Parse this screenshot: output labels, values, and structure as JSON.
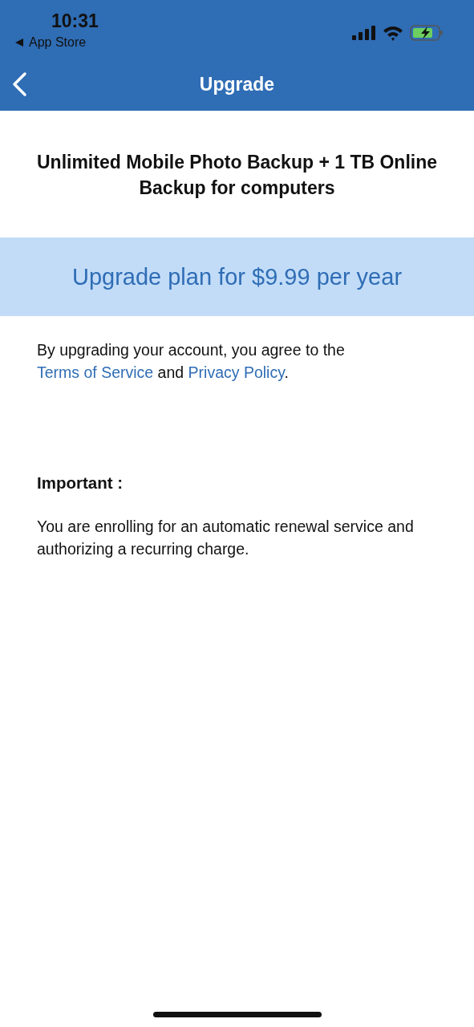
{
  "status_bar": {
    "time": "10:31",
    "back_app": "App Store"
  },
  "nav": {
    "title": "Upgrade"
  },
  "plan_title": "Unlimited Mobile Photo Backup + 1 TB Online Backup for computers",
  "upgrade_button": "Upgrade plan for $9.99 per year",
  "agreement": {
    "before": "By upgrading your account, you agree to the ",
    "terms_link": "Terms of Service",
    "middle": " and ",
    "privacy_link": "Privacy Policy",
    "after": "."
  },
  "important": {
    "heading": "Important :",
    "text": "You are enrolling for an automatic renewal service and authorizing a recurring charge."
  }
}
